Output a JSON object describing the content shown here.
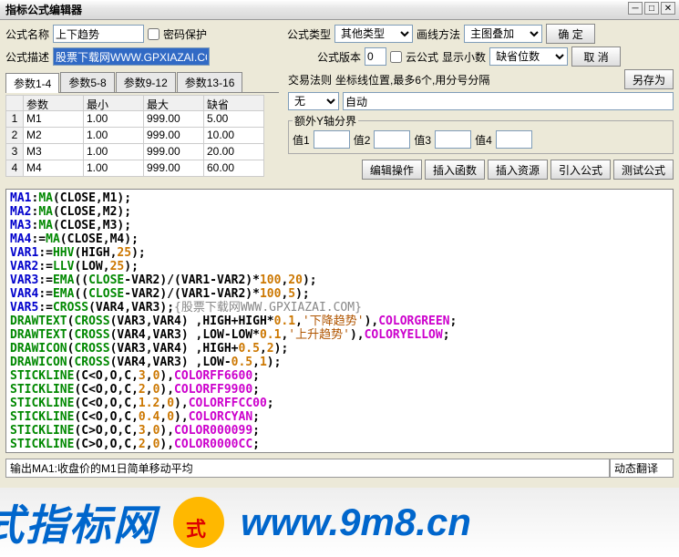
{
  "window": {
    "title": "指标公式编辑器"
  },
  "labels": {
    "formula_name": "公式名称",
    "pwd_protect": "密码保护",
    "formula_type": "公式类型",
    "draw_method": "画线方法",
    "ok": "确  定",
    "formula_desc": "公式描述",
    "formula_ver": "公式版本",
    "cloud": "云公式",
    "show_dec": "显示小数",
    "cancel": "取  消",
    "save_as": "另存为",
    "trade_rule": "交易法则",
    "coord_hint": "坐标线位置,最多6个,用分号分隔",
    "extra_y": "额外Y轴分界",
    "val1": "值1",
    "val2": "值2",
    "val3": "值3",
    "val4": "值4",
    "edit_op": "编辑操作",
    "ins_fn": "插入函数",
    "ins_res": "插入资源",
    "import_formula": "引入公式",
    "test_formula": "测试公式",
    "auto_translate": "动态翻译"
  },
  "values": {
    "formula_name": "上下趋势",
    "formula_desc": "股票下载网WWW.GPXIAZAI.COM",
    "formula_type": "其他类型",
    "draw_method": "主图叠加",
    "formula_ver": "0",
    "show_dec": "缺省位数",
    "trade_rule": "无",
    "coord": "自动"
  },
  "tabs": [
    "参数1-4",
    "参数5-8",
    "参数9-12",
    "参数13-16"
  ],
  "param_headers": [
    "参数",
    "最小",
    "最大",
    "缺省"
  ],
  "params": [
    {
      "n": "1",
      "name": "M1",
      "min": "1.00",
      "max": "999.00",
      "def": "5.00"
    },
    {
      "n": "2",
      "name": "M2",
      "min": "1.00",
      "max": "999.00",
      "def": "10.00"
    },
    {
      "n": "3",
      "name": "M3",
      "min": "1.00",
      "max": "999.00",
      "def": "20.00"
    },
    {
      "n": "4",
      "name": "M4",
      "min": "1.00",
      "max": "999.00",
      "def": "60.00"
    }
  ],
  "status": "输出MA1:收盘价的M1日简单移动平均",
  "banner1": "式指标网",
  "banner2": "www.9m8.cn"
}
